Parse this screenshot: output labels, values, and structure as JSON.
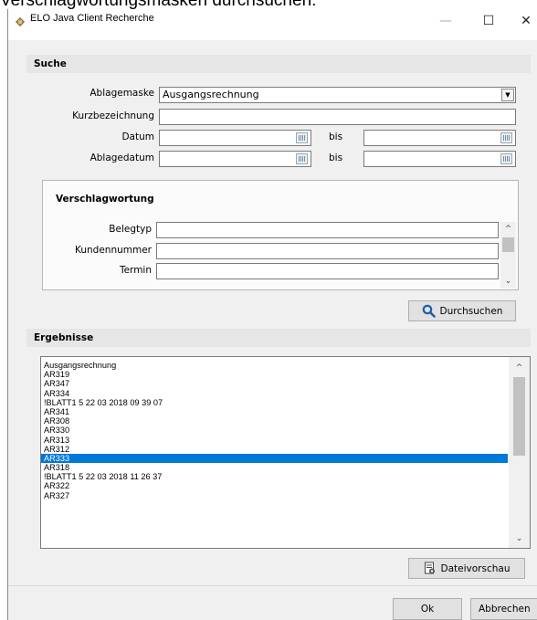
{
  "caption": "Verschlagwortungsmasken durchsuchen:",
  "window": {
    "title": "ELO Java Client Recherche",
    "minimize": "—",
    "maximize": "☐",
    "close": "✕"
  },
  "search": {
    "section_title": "Suche",
    "ablagemaske_label": "Ablagemaske",
    "ablagemaske_value": "Ausgangsrechnung",
    "kurz_label": "Kurzbezeichnung",
    "kurz_value": "",
    "datum_label": "Datum",
    "ablagedatum_label": "Ablagedatum",
    "bis_label": "bis",
    "group_title": "Verschlagwortung",
    "belegtyp_label": "Belegtyp",
    "kundennummer_label": "Kundennummer",
    "termin_label": "Termin",
    "search_button": "Durchsuchen"
  },
  "results": {
    "section_title": "Ergebnisse",
    "selected_index": 11,
    "items": [
      "Ausgangsrechnung",
      "AR319",
      "AR347",
      "AR334",
      "!BLATT1  5 22 03 2018 09 39 07",
      "AR341",
      "AR308",
      "AR330",
      "AR313",
      "AR312",
      "AR333",
      "AR318",
      "!BLATT1  5 22 03 2018 11 26 37",
      "AR322",
      "AR327"
    ],
    "preview_button": "Dateivorschau"
  },
  "footer": {
    "ok": "Ok",
    "cancel": "Abbrechen"
  },
  "colors": {
    "selection": "#0078d7",
    "search_icon": "#1a5ea8"
  }
}
